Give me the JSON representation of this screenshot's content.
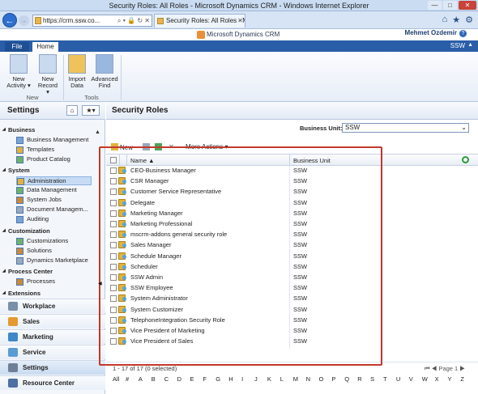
{
  "window": {
    "title": "Security Roles: All Roles - Microsoft Dynamics CRM - Windows Internet Explorer",
    "min": "—",
    "max": "□",
    "close": "✕"
  },
  "browser": {
    "back": "←",
    "forward": "→",
    "address": "https://crm.ssw.co...",
    "address_tools": "⌕ ▾ 🔒 ↻ ✕",
    "tab_title": "Security Roles: All Roles - M...",
    "tab_close": "✕",
    "icons": [
      "home-icon",
      "star-icon",
      "gear-icon"
    ]
  },
  "crm": {
    "logo_text": "Microsoft Dynamics CRM",
    "user_name": "Mehmet Ozdemir",
    "org": "SSW",
    "help": "?",
    "file_tab": "File",
    "home_tab": "Home"
  },
  "ribbon": {
    "buttons": [
      {
        "label1": "New",
        "label2": "Activity ▾",
        "icon": "new-activity-icon",
        "color": "#c9d9ee"
      },
      {
        "label1": "New",
        "label2": "Record ▾",
        "icon": "new-record-icon",
        "color": "#c9d9ee"
      },
      {
        "label1": "Import",
        "label2": "Data",
        "icon": "import-data-icon",
        "color": "#f0c25a"
      },
      {
        "label1": "Advanced",
        "label2": "Find",
        "icon": "advanced-find-icon",
        "color": "#9ab7df"
      }
    ],
    "groups": [
      "New",
      "Tools"
    ]
  },
  "sidebar": {
    "title": "Settings",
    "home_icon": "⌂",
    "fav_icon": "★▾",
    "scroll_up": "▲",
    "sections": [
      {
        "name": "Business",
        "items": [
          "Business Management",
          "Templates",
          "Product Catalog"
        ]
      },
      {
        "name": "System",
        "items": [
          "Administration",
          "Data Management",
          "System Jobs",
          "Document Managem...",
          "Auditing"
        ]
      },
      {
        "name": "Customization",
        "items": [
          "Customizations",
          "Solutions",
          "Dynamics Marketplace"
        ]
      },
      {
        "name": "Process Center",
        "items": [
          "Processes"
        ]
      },
      {
        "name": "Extensions",
        "items": []
      }
    ],
    "selected_item": "Administration",
    "areas": [
      {
        "label": "Workplace",
        "color": "#7a8fa8"
      },
      {
        "label": "Sales",
        "color": "#e39a32"
      },
      {
        "label": "Marketing",
        "color": "#3d87c9"
      },
      {
        "label": "Service",
        "color": "#5a9bd4"
      },
      {
        "label": "Settings",
        "color": "#6f7f95"
      },
      {
        "label": "Resource Center",
        "color": "#4d6fa3"
      }
    ],
    "selected_area": "Settings"
  },
  "main": {
    "title": "Security Roles",
    "business_unit_label": "Business Unit:",
    "business_unit_value": "SSW",
    "toolbar": {
      "new": "New",
      "more_actions": "More Actions ▾",
      "delete": "✕"
    },
    "columns": {
      "name": "Name ▲",
      "business_unit": "Business Unit"
    },
    "rows": [
      {
        "name": "CEO-Business Manager",
        "bu": "SSW"
      },
      {
        "name": "CSR Manager",
        "bu": "SSW"
      },
      {
        "name": "Customer Service Representative",
        "bu": "SSW"
      },
      {
        "name": "Delegate",
        "bu": "SSW"
      },
      {
        "name": "Marketing Manager",
        "bu": "SSW"
      },
      {
        "name": "Marketing Professional",
        "bu": "SSW"
      },
      {
        "name": "mscrm-addons general security role",
        "bu": "SSW"
      },
      {
        "name": "Sales Manager",
        "bu": "SSW"
      },
      {
        "name": "Schedule Manager",
        "bu": "SSW"
      },
      {
        "name": "Scheduler",
        "bu": "SSW"
      },
      {
        "name": "SSW Admin",
        "bu": "SSW"
      },
      {
        "name": "SSW Employee",
        "bu": "SSW"
      },
      {
        "name": "System Administrator",
        "bu": "SSW"
      },
      {
        "name": "System Customizer",
        "bu": "SSW"
      },
      {
        "name": "TelephoneIntegration Security Role",
        "bu": "SSW"
      },
      {
        "name": "Vice President of Marketing",
        "bu": "SSW"
      },
      {
        "name": "Vice President of Sales",
        "bu": "SSW"
      }
    ],
    "paging": {
      "count": "1 - 17 of 17 (0 selected)",
      "page": "⏮ ◀ Page 1 ▶"
    },
    "alphabet": [
      "All",
      "#",
      "A",
      "B",
      "C",
      "D",
      "E",
      "F",
      "G",
      "H",
      "I",
      "J",
      "K",
      "L",
      "M",
      "N",
      "O",
      "P",
      "Q",
      "R",
      "S",
      "T",
      "U",
      "V",
      "W",
      "X",
      "Y",
      "Z"
    ]
  },
  "colors": {
    "highlight": "#c2392b",
    "ribbon_tab": "#2a5ea8",
    "accent": "#2f6fcf"
  }
}
